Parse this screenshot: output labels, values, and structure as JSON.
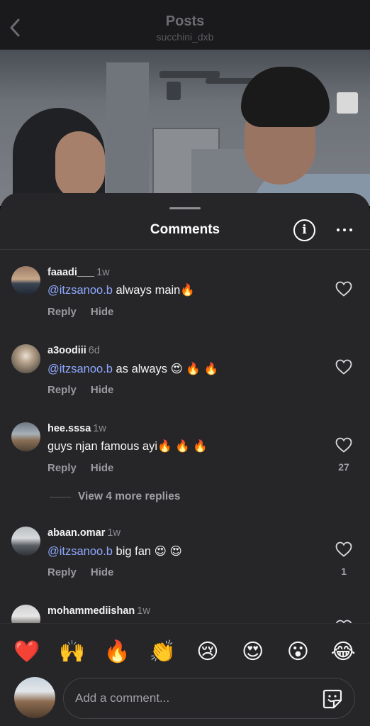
{
  "header": {
    "title": "Posts",
    "subtitle": "succhini_dxb"
  },
  "sheet": {
    "title": "Comments"
  },
  "comments": [
    {
      "username": "faaadi___",
      "time": "1w",
      "mention": "@itzsanoo.b",
      "text": " always main🔥",
      "reply": "Reply",
      "hide": "Hide",
      "likes": ""
    },
    {
      "username": "a3oodiii",
      "time": "6d",
      "mention": "@itzsanoo.b",
      "text": " as always 😍 🔥 🔥",
      "reply": "Reply",
      "hide": "Hide",
      "likes": ""
    },
    {
      "username": "hee.sssa",
      "time": "1w",
      "mention": "",
      "text": "guys njan famous ayi🔥 🔥 🔥",
      "reply": "Reply",
      "hide": "Hide",
      "likes": "27"
    },
    {
      "username": "abaan.omar",
      "time": "1w",
      "mention": "@itzsanoo.b",
      "text": " big fan 😍 😍",
      "reply": "Reply",
      "hide": "Hide",
      "likes": "1"
    },
    {
      "username": "mohammediishan",
      "time": "1w",
      "mention": "",
      "text": "",
      "reply": "",
      "hide": "",
      "likes": ""
    }
  ],
  "view_replies": "View 4 more replies",
  "emoji_bar": [
    "❤️",
    "🙌",
    "🔥",
    "👏",
    "😢",
    "😍",
    "😮",
    "😂"
  ],
  "composer": {
    "placeholder": "Add a comment..."
  },
  "icons": {
    "back": "chevron-left-icon",
    "info": "info-icon",
    "more": "more-horizontal-icon",
    "like": "heart-outline-icon",
    "sticker": "sticker-icon"
  },
  "colors": {
    "sheet_bg": "#262628",
    "mention": "#8ea8ff",
    "muted": "#8e8e93"
  }
}
